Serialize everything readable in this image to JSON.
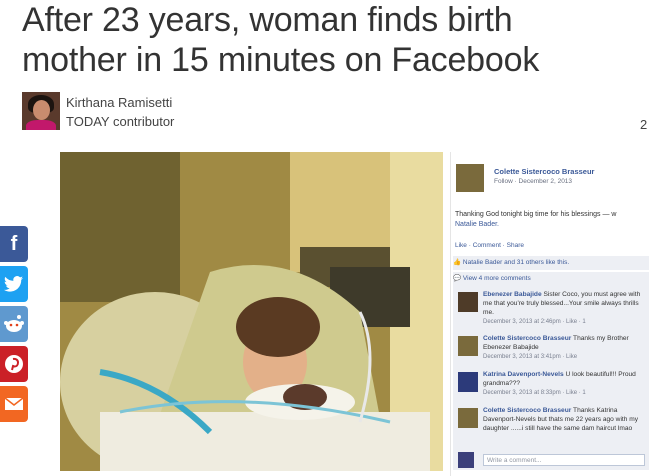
{
  "article": {
    "headline_line1": "After 23 years, woman finds birth",
    "headline_line2": "mother in 15 minutes on Facebook",
    "author_name": "Kirthana Ramisetti",
    "author_role": "TODAY contributor",
    "date_fragment": "2"
  },
  "share_bar": [
    {
      "name": "facebook",
      "glyph": "f",
      "color": "#3b5998"
    },
    {
      "name": "twitter",
      "glyph": "t",
      "color": "#1da1f2"
    },
    {
      "name": "reddit",
      "glyph": "r",
      "color": "#5f99cf"
    },
    {
      "name": "pinterest",
      "glyph": "P",
      "color": "#cb2027"
    },
    {
      "name": "email",
      "glyph": "✉",
      "color": "#f26722"
    }
  ],
  "facebook_post": {
    "author": "Colette Sistercoco Brasseur",
    "meta": "Follow · December 2, 2013",
    "status": "Thanking God tonight big time for his blessings — w",
    "status_tag": "Natalie Bader.",
    "actions": "Like · Comment · Share",
    "likes": "Natalie Bader and 31 others like this.",
    "more_comments": "View 4 more comments",
    "comments": [
      {
        "author": "Ebenezer Babajide",
        "text": "Sister Coco, you must agree with me that you're truly blessed...Your smile always thrills me.",
        "meta": "December 3, 2013 at 2:46pm · Like · 1"
      },
      {
        "author": "Colette Sistercoco Brasseur",
        "text": "Thanks my Brother Ebenezer Babajide",
        "meta": "December 3, 2013 at 3:41pm · Like"
      },
      {
        "author": "Katrina Davenport-Nevels",
        "text": "U look beautiful!!! Proud grandma???",
        "meta": "December 3, 2013 at 8:33pm · Like · 1"
      },
      {
        "author": "Colette Sistercoco Brasseur",
        "text": "Thanks Katrina Davenport-Nevels but thats me 22 years ago with my daughter ......i still have the same dam haircut lmao",
        "meta": ""
      }
    ],
    "write_placeholder": "Write a comment..."
  },
  "colors": {
    "fb_blue": "#3b5998",
    "fb_bg": "#edeff4",
    "headline": "#333333"
  }
}
